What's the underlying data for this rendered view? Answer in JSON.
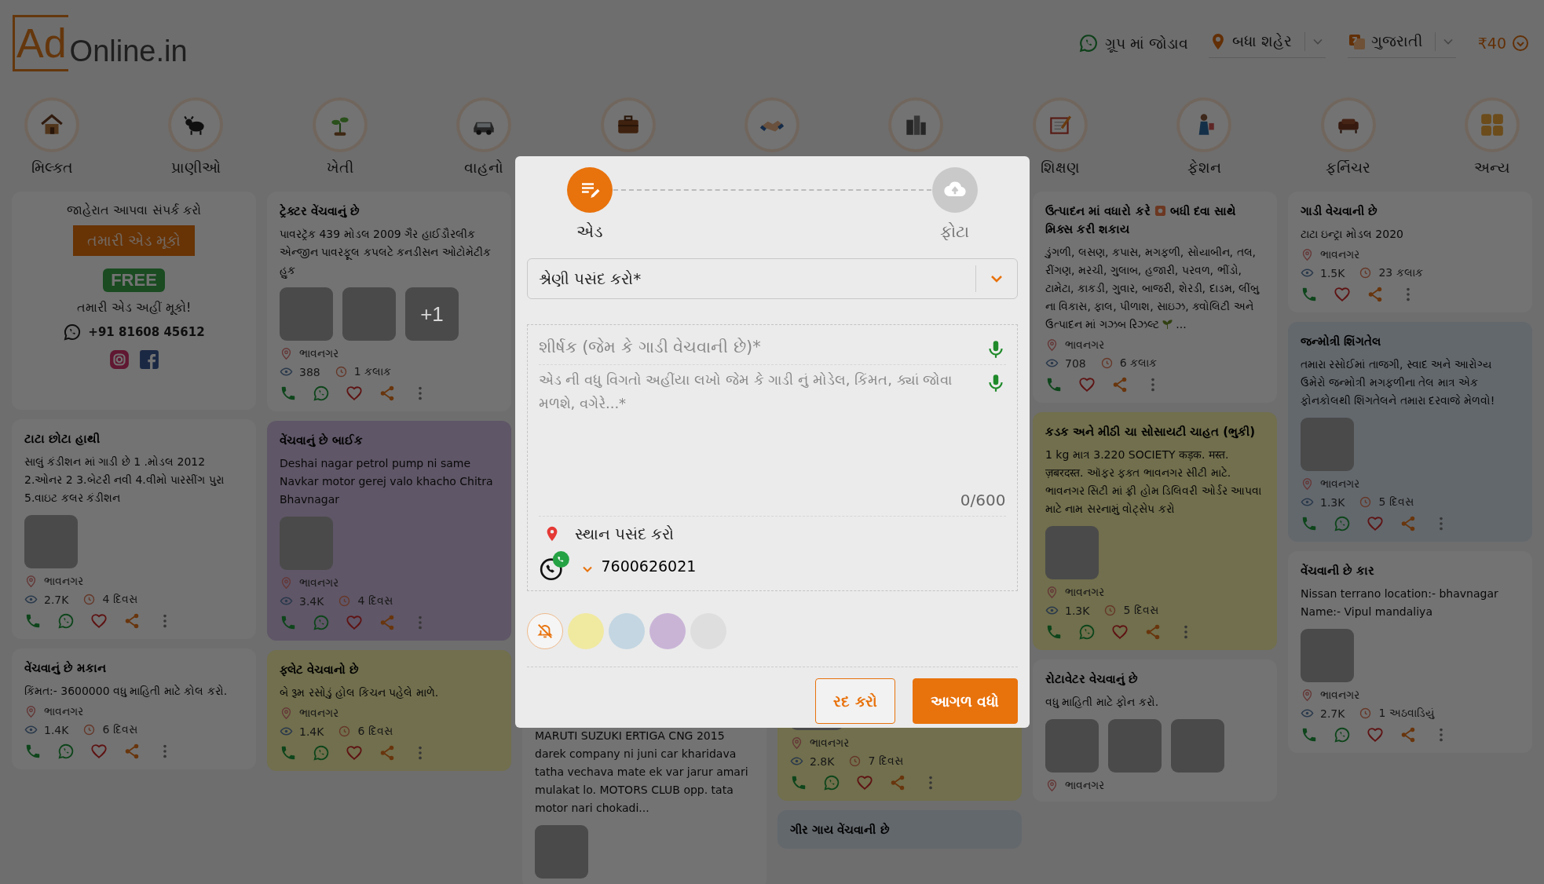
{
  "header": {
    "logo": {
      "part1": "Ad",
      "part2": "Online.in"
    },
    "group_link": "ગ્રૂપ માં જોડાવ",
    "city": "બધા શહેર",
    "language": "ગુજરાતી",
    "wallet": "₹40"
  },
  "categories": [
    {
      "label": "મિલ્કત"
    },
    {
      "label": "પ્રાણીઓ"
    },
    {
      "label": "ખેતી"
    },
    {
      "label": "વાહનો"
    },
    {
      "label": "શિક્ષણ"
    },
    {
      "label": "ફેશન"
    },
    {
      "label": "ફર્નિચર"
    },
    {
      "label": "અન્ય"
    }
  ],
  "columns": [
    {
      "cards": [
        {
          "kind": "promo",
          "heading": "જાહેરાત આપવા સંપર્ક કરો",
          "button": "તમારી એડ મૂકો",
          "badge": "FREE",
          "tagline": "તમારી એડ અહીં મૂકો!",
          "phone": "+91 81608 45612"
        },
        {
          "kind": "ad",
          "color": "#737373",
          "title": "ટાટા છોટા હાથી",
          "body": "સાલું કંડીશન માં ગાડી છે 1 .મોડલ 2012 2.ઓનર 2 3.બેટરી નવી 4.વીમો પારસીંગ પુરા 5.વાઇટ કલર કંડીશન",
          "photos": [
            {
              "kind": "photo"
            }
          ],
          "location": "ભાવનગર",
          "views": "2.7K",
          "age": "4 દિવસ",
          "whatsapp": true
        },
        {
          "kind": "ad",
          "color": "#737373",
          "title": "વેંચવાનું છે મકાન",
          "body": "કિંમત:- 3600000 વધુ માહિતી માટે કોલ કરો.",
          "location": "ભાવનગર",
          "views": "1.4K",
          "age": "6 દિવસ",
          "whatsapp": true
        }
      ]
    },
    {
      "cards": [
        {
          "kind": "ad",
          "color": "#737373",
          "title": "ટ્રેક્ટર વેંચવાનું છે",
          "body": "પાવરટ્રૅક 439 મોડલ 2009 ગૈર હાઈડૌરલીક એન્જીન પાવરફૂલ કપલટે કનડીસન ઓટોમેટીક હુક",
          "photos": [
            {
              "kind": "photo"
            },
            {
              "kind": "photo"
            },
            {
              "kind": "photo",
              "more": "+1"
            }
          ],
          "location": "ભાવનગર",
          "views": "388",
          "age": "1 કલાક",
          "whatsapp": true
        },
        {
          "kind": "ad",
          "color": "#5f5667",
          "title": "વેંચવાનું છે બાઈક",
          "body": "Deshai nagar petrol pump ni same Navkar motor gerej valo khacho Chitra Bhavnagar",
          "photos": [
            {
              "kind": "photo"
            }
          ],
          "location": "ભાવનગર",
          "views": "3.4K",
          "age": "4 દિવસ",
          "whatsapp": true
        },
        {
          "kind": "ad",
          "color": "#716f4d",
          "title": "ફ્લેટ વેચવાનો છે",
          "body": "બે રૂમ રસોડું હોલ કિચન પહેલે માળે.",
          "location": "ભાવનગર",
          "views": "1.4K",
          "age": "6 દિવસ",
          "whatsapp": true
        }
      ]
    },
    {
      "cards": [
        {
          "kind": "ad",
          "color": "#737373",
          "body": "MARUTI SUZUKI ERTIGA CNG 2015 darek company ni juni car kharidava tatha vechava mate ek var jarur amari mulakat lo. MOTORS CLUB opp. tata motor nari chokadi...",
          "photos": [
            {
              "kind": "photo"
            }
          ]
        }
      ]
    },
    {
      "cards": [
        {
          "kind": "ad",
          "color": "#716f4d",
          "photos": [
            {
              "kind": "photo"
            }
          ],
          "location": "ભાવનગર",
          "views": "2.8K",
          "age": "7 દિવસ",
          "whatsapp": true
        },
        {
          "kind": "ad",
          "color": "#63686d",
          "title": "ગીર ગાય વેંચવાની છે"
        }
      ]
    },
    {
      "cards": [
        {
          "kind": "ad",
          "color": "#737373",
          "title": "ઉત્પાદન માં વધારો કરે",
          "title_end": "બધી દવા સાથે મિક્સ કરી શકાય",
          "body": "ડુંગળી, લસણ, કપાસ, મગફળી, સોયાબીન, તલ, રીંગણ, મરચી, ગુલાબ, હજારી, પરવળ, ભીંડો, ટામેટા, કાકડી, ગુવાર, બાજરી, શેરડી, દાડમ, લીંબુ ના વિકાસ, ફાલ, પીળાશ, સાઇઝ, ક્વોલિટી અને ઉત્પાદન માં ગઝબ રિઝલ્ટ",
          "body_tail": "...",
          "location": "ભાવનગર",
          "views": "708",
          "age": "6 કલાક",
          "whatsapp": false
        },
        {
          "kind": "ad",
          "color": "#716f4d",
          "title": "કડક અને મીઠી ચા સોસાયટી ચાહત (ભુકી)",
          "body": "1 kg માત્ર 3.220 SOCIETY कड़क. मस्त. ज़बरदस्त. ઑફર ફક્ત ભાવનગર સીટી માટે. ભાવનગર સિટી માં ફ્રી હોમ ડિલિવરી ઓર્ડર આપવા માટે નામ સરનામું વોટ્સેપ કરો",
          "photos": [
            {
              "kind": "photo"
            }
          ],
          "location": "ભાવનગર",
          "views": "1.3K",
          "age": "5 દિવસ",
          "whatsapp": true
        },
        {
          "kind": "ad",
          "color": "#737373",
          "title": "રોટાવેટર વેચવાનું છે",
          "body": "વધુ માહિતી માટે ફોન કરો.",
          "photos": [
            {
              "kind": "photo"
            },
            {
              "kind": "photo"
            },
            {
              "kind": "photo"
            }
          ],
          "location": "ભાવનગર"
        }
      ]
    },
    {
      "cards": [
        {
          "kind": "ad",
          "color": "#737373",
          "title": "ગાડી વેચવાની છે",
          "body": "ટાટા ઇન્ટ્રા મોડલ 2020",
          "location": "ભાવનગર",
          "views": "1.5K",
          "age": "23 કલાક",
          "whatsapp": false
        },
        {
          "kind": "ad",
          "color": "#63686d",
          "title": "જન્મોત્રી શિંગતેલ",
          "body": "તમારા રસોઈમાં તાજગી, સ્વાદ અને આરોગ્ય ઉમેરો જન્મોત્રી મગફળીના તેલ માત્ર એક ફોનકોલથી શિંગતેલને તમારા દરવાજે મેળવો!",
          "photos": [
            {
              "kind": "photo"
            }
          ],
          "location": "ભાવનગર",
          "views": "1.3K",
          "age": "5 દિવસ",
          "whatsapp": true
        },
        {
          "kind": "ad",
          "color": "#737373",
          "title": "વેંચવાની છે કાર",
          "body": "Nissan terrano location:- bhavnagar Name:- Vipul mandaliya",
          "photos": [
            {
              "kind": "photo"
            }
          ],
          "location": "ભાવનગર",
          "views": "2.7K",
          "age": "1 અઠવાડિયું",
          "whatsapp": true
        }
      ]
    }
  ],
  "modal": {
    "steps": [
      {
        "label": "એડ",
        "selected": true
      },
      {
        "label": "ફોટા",
        "selected": false
      }
    ],
    "category_select": {
      "placeholder": "શ્રેણી પસંદ કરો*"
    },
    "title_field": {
      "placeholder": "શીર્ષક (જેમ કે ગાડી વેચવાની છે)*"
    },
    "details_field": {
      "placeholder": "એડ ની વધુ વિગતો અહીંયા લખો જેમ કે ગાડી નું મોડેલ, કિંમત, ક્યાં જોવા મળશે, વગેરે...*"
    },
    "counter": "0/600",
    "location": "સ્થાન પસંદ કરો",
    "phone": "7600626021",
    "swatches": [
      {
        "kind": "none",
        "selected": true
      },
      {
        "kind": "color",
        "color": "#f0e9a0",
        "selected": false
      },
      {
        "kind": "color",
        "color": "#c3d6e2",
        "selected": false
      },
      {
        "kind": "color",
        "color": "#c9b4d6",
        "selected": false
      },
      {
        "kind": "color",
        "color": "#dedede",
        "selected": false
      }
    ],
    "buttons": [
      {
        "label": "રદ કરો",
        "kind": "outline"
      },
      {
        "label": "આગળ વધો",
        "kind": "primary"
      }
    ]
  }
}
